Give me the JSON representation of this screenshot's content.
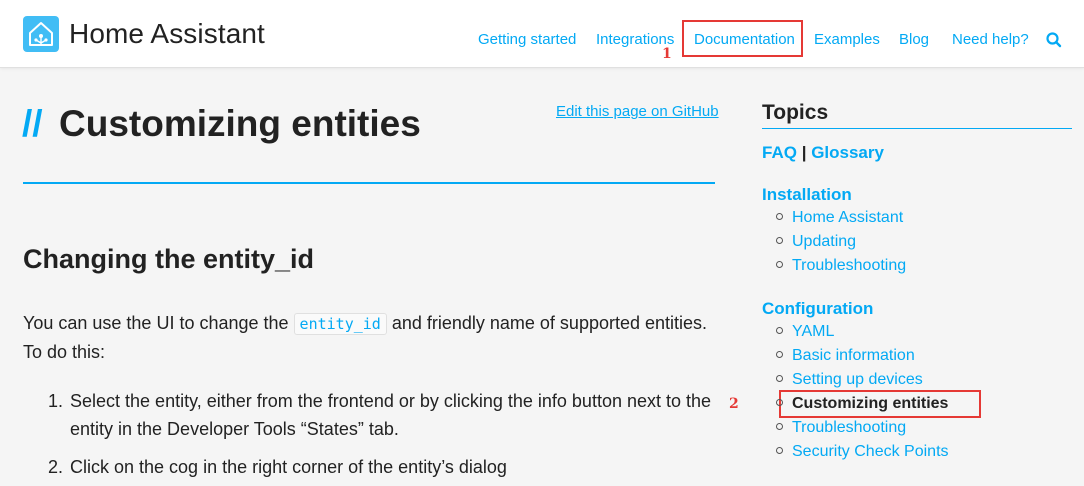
{
  "header": {
    "brand": "Home Assistant",
    "nav": [
      "Getting started",
      "Integrations",
      "Documentation",
      "Examples",
      "Blog",
      "Need help?"
    ],
    "search_icon": "search-icon",
    "logo_icon": "home-assistant-logo-icon"
  },
  "callouts": [
    "1",
    "2"
  ],
  "article": {
    "title_prefix": "//",
    "title": "Customizing entities",
    "edit_link": "Edit this page on GitHub",
    "section_heading": "Changing the entity_id",
    "para_before": "You can use the UI to change the ",
    "para_code": "entity_id",
    "para_after": " and friendly name of supported entities. To do this:",
    "steps": [
      {
        "num": "1.",
        "text": "Select the entity, either from the frontend or by clicking the info button next to the entity in the Developer Tools “States” tab."
      },
      {
        "num": "2.",
        "text": "Click on the cog in the right corner of the entity’s dialog"
      }
    ]
  },
  "sidebar": {
    "title": "Topics",
    "faq": "FAQ",
    "separator": "|",
    "glossary": "Glossary",
    "installation": {
      "title": "Installation",
      "items": [
        "Home Assistant",
        "Updating",
        "Troubleshooting"
      ]
    },
    "configuration": {
      "title": "Configuration",
      "items": [
        "YAML",
        "Basic information",
        "Setting up devices",
        "Customizing entities",
        "Troubleshooting",
        "Security Check Points"
      ]
    }
  },
  "colors": {
    "accent": "#03a9f4",
    "logo": "#41bdf5",
    "callout": "#e53935",
    "text": "#222222",
    "background": "#f5f5f5"
  }
}
